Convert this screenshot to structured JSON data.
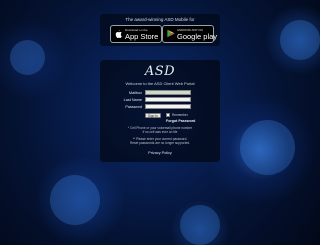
{
  "app_promo": {
    "tagline": "The award-winning ASD Mobile for",
    "app_store": {
      "small": "Download on the",
      "big": "App Store"
    },
    "google_play": {
      "small": "ANDROID APP ON",
      "big": "Google play"
    }
  },
  "portal": {
    "logo": "ASD",
    "welcome": "Welcome to the ASD Client Web Portal",
    "fields": [
      {
        "label": "Mailbox",
        "value": ""
      },
      {
        "label": "Last Name",
        "value": ""
      },
      {
        "label": "Password",
        "value": ""
      }
    ],
    "signin_label": "Sign In",
    "remember_label": "Remember",
    "forgot_label": "Forgot Password",
    "notice_1": [
      "* Cell Phone or your voicemail phone number",
      "if no cell was ever on file"
    ],
    "notice_2": [
      "** Please enter your current password.",
      "Reset passwords are no longer supported."
    ],
    "privacy_label": "Privacy Policy"
  },
  "colors": {
    "background": "#041334",
    "panel": "#000000",
    "accent": "#3c8cff"
  }
}
